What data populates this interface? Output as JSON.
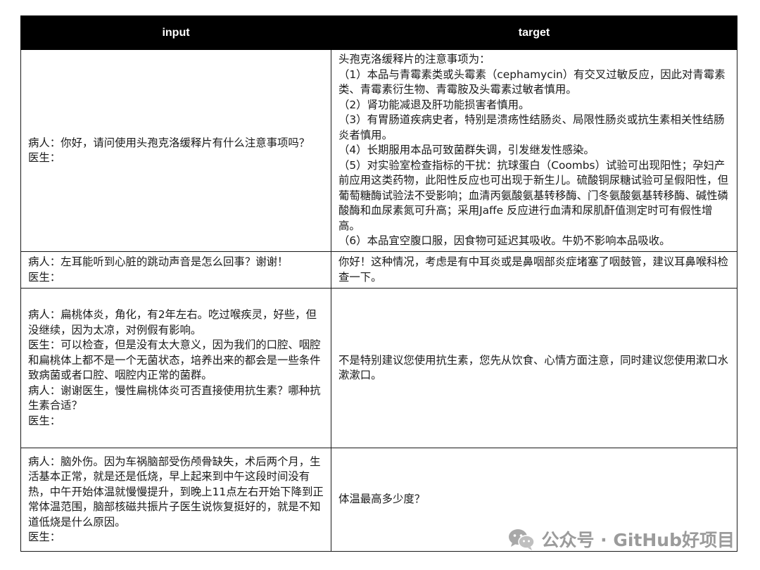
{
  "table": {
    "headers": [
      "input",
      "target"
    ],
    "rows": [
      {
        "input": "病人：你好，请问使用头孢克洛缓释片有什么注意事项吗？\n医生：",
        "target": "头孢克洛缓释片的注意事项为：\n（1）本品与青霉素类或头霉素（cephamycin）有交叉过敏反应，因此对青霉素类、青霉素衍生物、青霉胺及头霉素过敏者慎用。\n（2）肾功能减退及肝功能损害者慎用。\n（3）有胃肠道疾病史者，特别是溃疡性结肠炎、局限性肠炎或抗生素相关性结肠炎者慎用。\n（4）长期服用本品可致菌群失调，引发继发性感染。\n（5）对实验室检查指标的干扰：抗球蛋白（Coombs）试验可出现阳性；孕妇产前应用这类药物，此阳性反应也可出现于新生儿。硫酸铜尿糖试验可呈假阳性，但葡萄糖酶试验法不受影响；血清丙氨酸氨基转移酶、门冬氨酸氨基转移酶、碱性磷酸酶和血尿素氮可升高；采用Jaffe 反应进行血清和尿肌酐值测定时可有假性增高。\n（6）本品宜空腹口服，因食物可延迟其吸收。牛奶不影响本品吸收。"
      },
      {
        "input": "病人：左耳能听到心脏的跳动声音是怎么回事？谢谢！\n医生：",
        "target": "你好！这种情况，考虑是有中耳炎或是鼻咽部炎症堵塞了咽鼓管，建议耳鼻喉科检查一下。"
      },
      {
        "input": "病人：扁桃体炎，角化，有2年左右。吃过喉疾灵，好些，但没继续，因为太凉，对例假有影响。\n医生：可以检查，但是没有太大意义，因为我们的口腔、咽腔和扁桃体上都不是一个无菌状态，培养出来的都会是一些条件致病菌或者口腔、咽腔内正常的菌群。\n病人：谢谢医生，慢性扁桃体炎可否直接使用抗生素？哪种抗生素合适？\n医生：",
        "target": "不是特别建议您使用抗生素，您先从饮食、心情方面注意，同时建议您使用漱口水漱漱口。"
      },
      {
        "input": "病人：脑外伤。因为车祸脑部受伤颅骨缺失，术后两个月，生活基本正常，就是还是低烧，早上起来到中午这段时间没有热，中午开始体温就慢慢提升，到晚上11点左右开始下降到正常体温范围，脑部核磁共振片子医生说恢复挺好的，就是不知道低烧是什么原因。\n医生：",
        "target": "体温最高多少度？"
      }
    ]
  },
  "watermark": {
    "text": "公众号 · GitHub好项目",
    "icon": "wechat-icon",
    "color": "#8a8a8a"
  }
}
